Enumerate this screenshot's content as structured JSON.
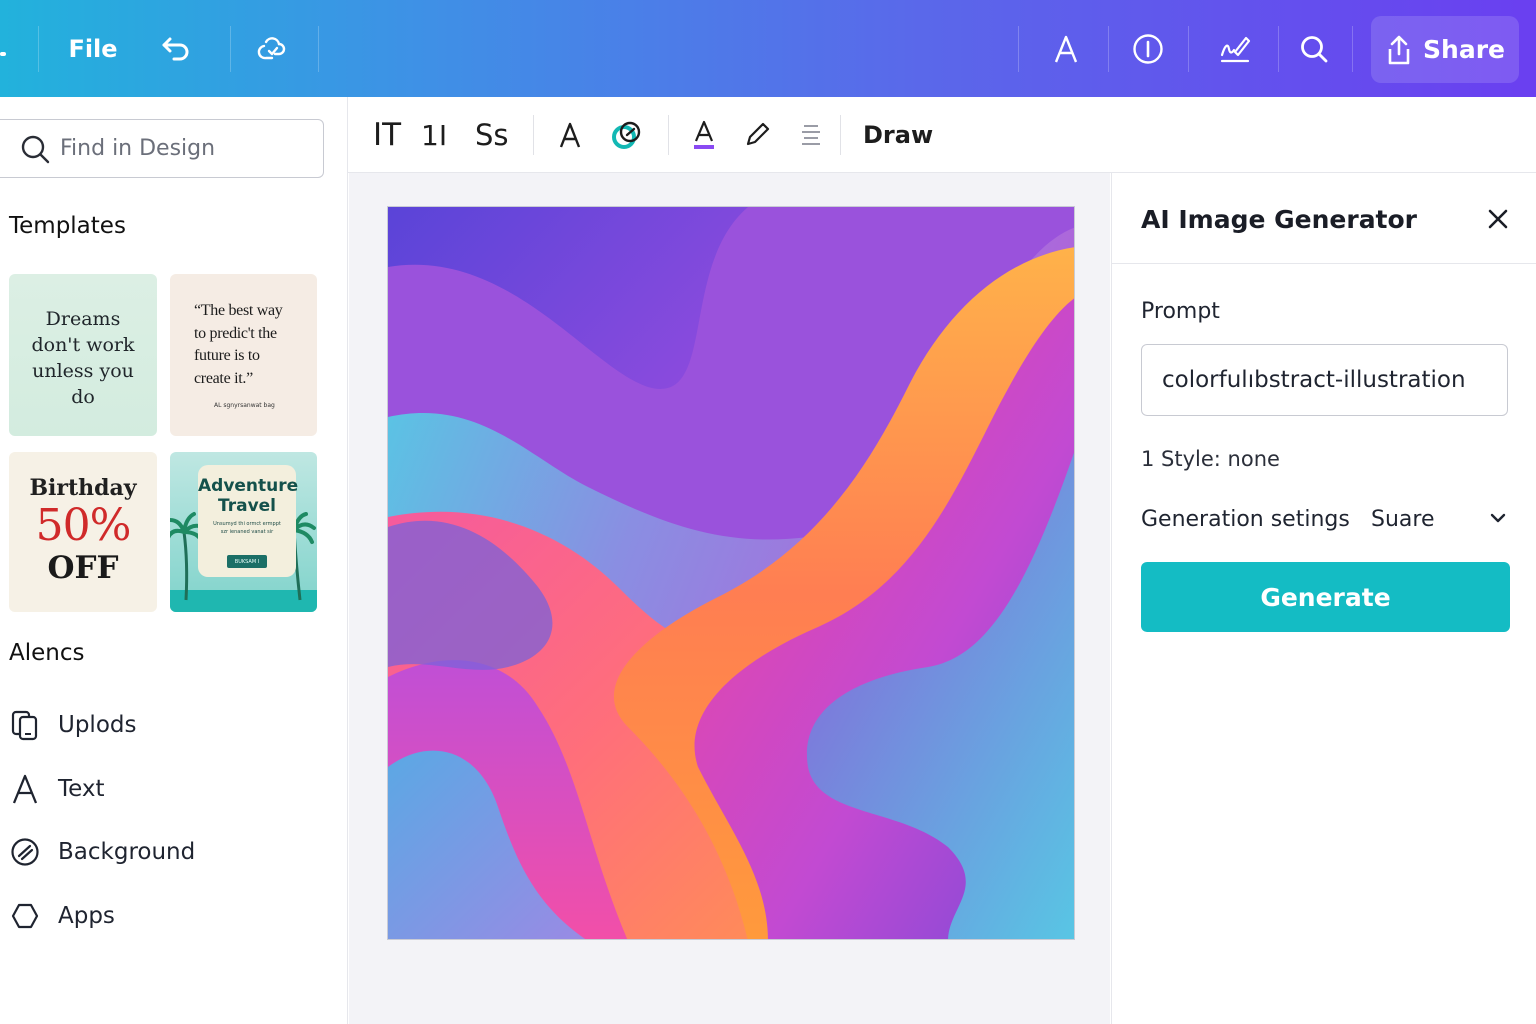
{
  "topbar": {
    "file_label": "File",
    "share_label": "Share"
  },
  "search": {
    "placeholder": "Find in Design"
  },
  "sidebar": {
    "templates_title": "Templates",
    "templates": [
      {
        "text": "Dreams don't work unless you do"
      },
      {
        "text": "“The best way to predic't the future is to create it.”",
        "signature": "AL sgnyrsanwat bag"
      },
      {
        "line1": "Birthday",
        "line2": "50%",
        "line3": "OFF"
      },
      {
        "title": "Adventure Travel",
        "body": "Unsumyd thi ormct ermppt szr ienaned vanat sir",
        "button": "BUKSAM I"
      }
    ],
    "elements_title": "Alencs",
    "nav": [
      {
        "label": "Uplods",
        "icon": "uploads-icon"
      },
      {
        "label": "Text",
        "icon": "text-icon"
      },
      {
        "label": "Background",
        "icon": "background-icon"
      },
      {
        "label": "Apps",
        "icon": "apps-icon"
      }
    ]
  },
  "toolbar": {
    "font_style": "IT",
    "font_size": "1I",
    "case": "Ss",
    "text_tool": "A",
    "color_tool": "A",
    "draw_label": "Draw",
    "underline_color": "#8a4af3"
  },
  "ai_panel": {
    "title": "AI Image Generator",
    "prompt_label": "Prompt",
    "prompt_value": "colorfulıbstract-illustration",
    "style_text": "1 Style: none",
    "generation_label": "Generation setings",
    "generation_value": "Suare",
    "generate_label": "Generate",
    "accent_color": "#14bcc4"
  },
  "colors": {
    "topbar_gradient": [
      "#22b2dc",
      "#5a68ea",
      "#6a3ff0"
    ],
    "birthday_red": "#d02a2a"
  }
}
